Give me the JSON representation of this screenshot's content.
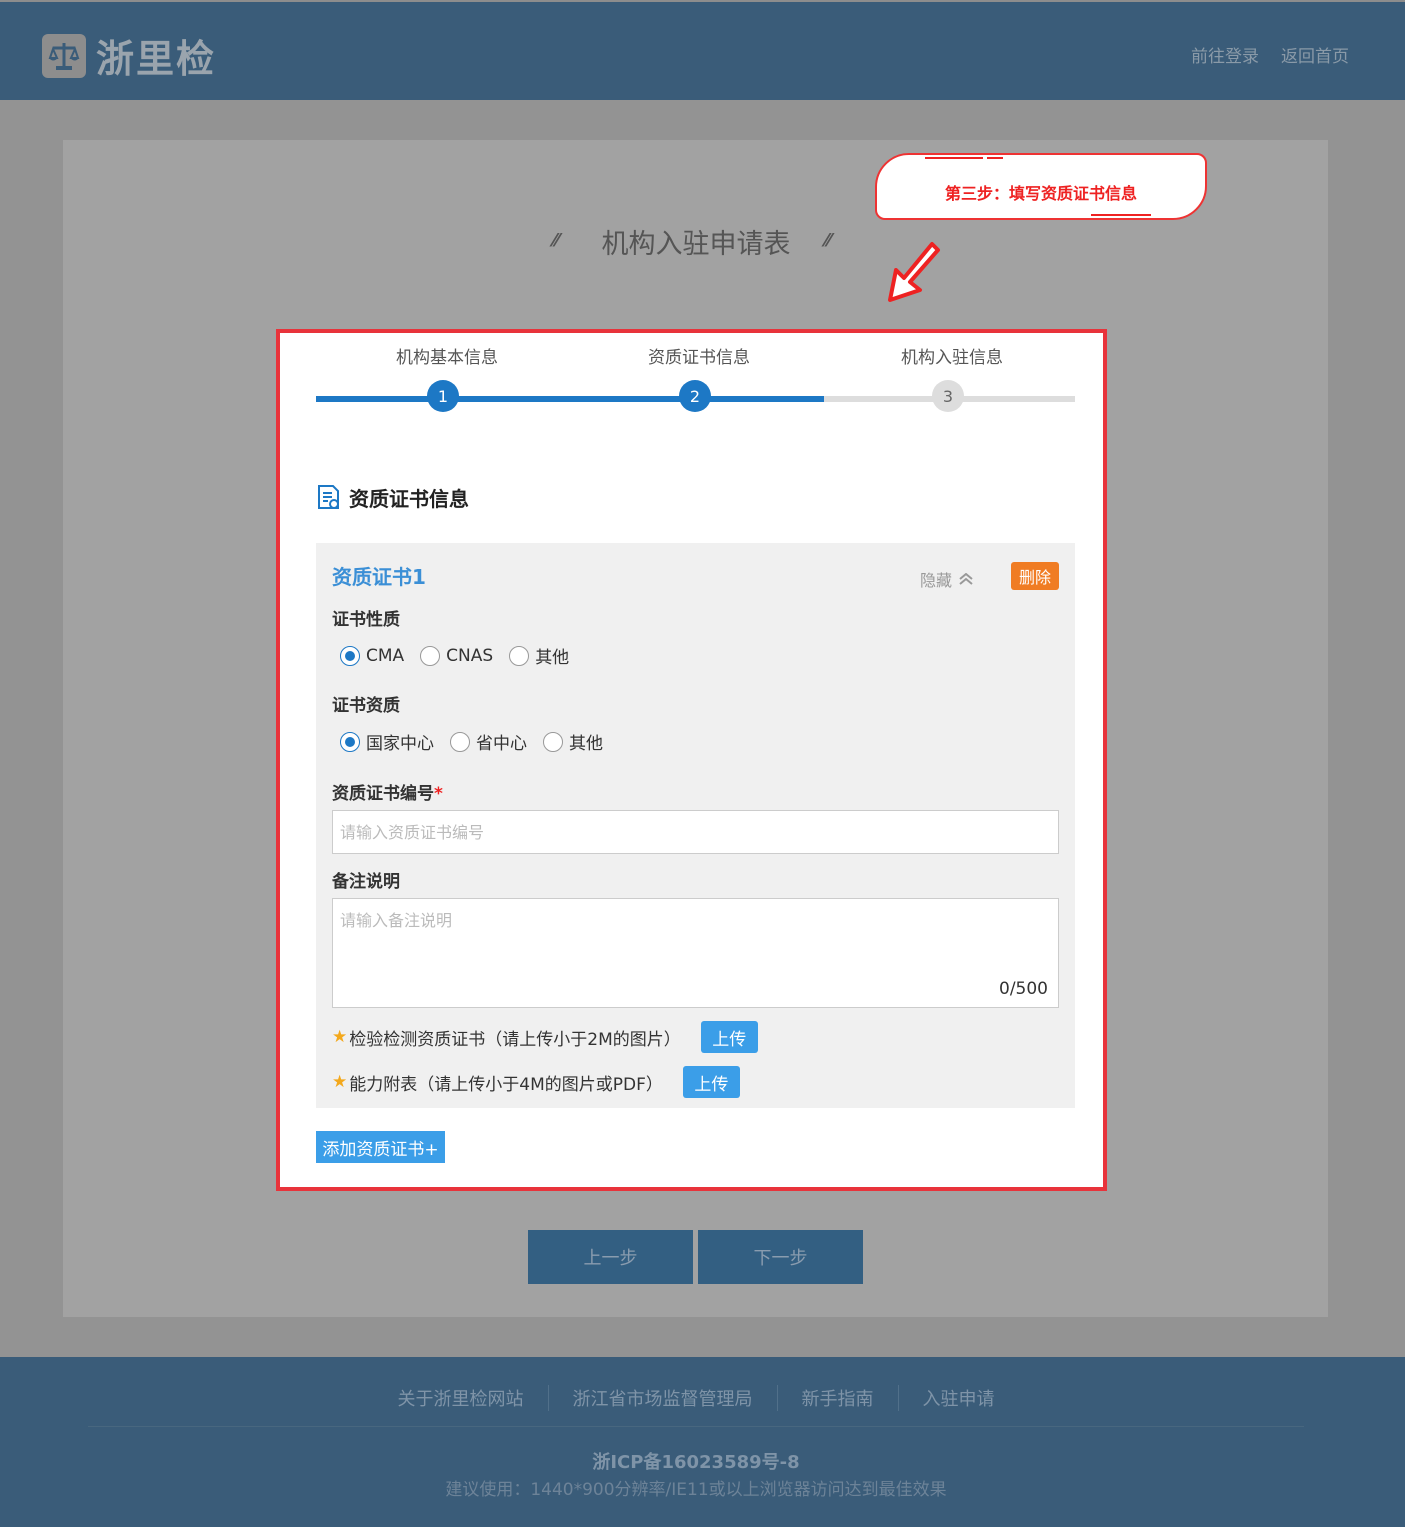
{
  "header": {
    "site_name": "浙里检",
    "links": [
      "前往登录",
      "返回首页"
    ]
  },
  "page": {
    "title": "机构入驻申请表"
  },
  "callout": {
    "text": "第三步：填写资质证书信息"
  },
  "steps": [
    {
      "label": "机构基本信息",
      "number": "1",
      "state": "done"
    },
    {
      "label": "资质证书信息",
      "number": "2",
      "state": "current"
    },
    {
      "label": "机构入驻信息",
      "number": "3",
      "state": "pending"
    }
  ],
  "section": {
    "title": "资质证书信息"
  },
  "certificate": {
    "name": "资质证书1",
    "hide_label": "隐藏",
    "delete_label": "删除",
    "nature_label": "证书性质",
    "nature_options": [
      "CMA",
      "CNAS",
      "其他"
    ],
    "nature_selected": "CMA",
    "qualification_label": "证书资质",
    "qualification_options": [
      "国家中心",
      "省中心",
      "其他"
    ],
    "qualification_selected": "国家中心",
    "number_label": "资质证书编号",
    "required_mark": "*",
    "number_placeholder": "请输入资质证书编号",
    "remark_label": "备注说明",
    "remark_placeholder": "请输入备注说明",
    "remark_counter": "0/500",
    "upload1_text": "检验检测资质证书（请上传小于2M的图片）",
    "upload2_text": "能力附表（请上传小于4M的图片或PDF）",
    "upload_label": "上传"
  },
  "add_button": "添加资质证书+",
  "nav": {
    "prev": "上一步",
    "next": "下一步"
  },
  "footer": {
    "links": [
      "关于浙里检网站",
      "浙江省市场监督管理局",
      "新手指南",
      "入驻申请"
    ],
    "icp": "浙ICP备16023589号-8",
    "advice": "建议使用：1440*900分辨率/IE11或以上浏览器访问达到最佳效果"
  },
  "colors": {
    "header_bg": "#3a5c79",
    "accent": "#1d78c5",
    "highlight_border": "#e8333b",
    "delete": "#f07c23",
    "upload": "#3b9ee8"
  }
}
